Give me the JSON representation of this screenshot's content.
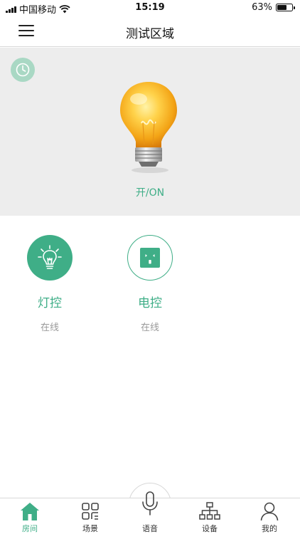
{
  "status_bar": {
    "carrier": "中国移动",
    "time": "15:19",
    "battery": "63%",
    "battery_level": 0.63
  },
  "header": {
    "title": "测试区域"
  },
  "hero": {
    "power_status": "开/ON"
  },
  "devices": [
    {
      "name": "灯控",
      "status": "在线",
      "icon": "light-bulb-icon"
    },
    {
      "name": "电控",
      "status": "在线",
      "icon": "power-socket-icon"
    }
  ],
  "bottom_nav": {
    "items": [
      {
        "label": "房间",
        "icon": "house-icon",
        "active": true
      },
      {
        "label": "场景",
        "icon": "scene-grid-icon",
        "active": false
      },
      {
        "label": "语音",
        "icon": "microphone-icon",
        "active": false
      },
      {
        "label": "设备",
        "icon": "device-tree-icon",
        "active": false
      },
      {
        "label": "我的",
        "icon": "user-icon",
        "active": false
      }
    ]
  },
  "colors": {
    "accent": "#3fae87",
    "hero_background": "#ededed",
    "muted_text": "#9a9a9a"
  }
}
